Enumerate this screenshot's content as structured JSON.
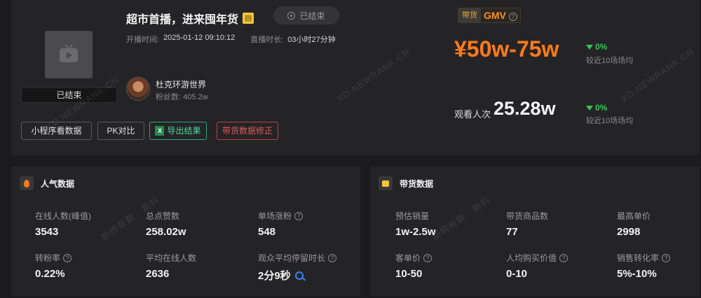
{
  "live": {
    "title": "超市首播，进来囤年货",
    "status": "已结束",
    "cover_status": "已结束",
    "start_label": "开播时间:",
    "start_time": "2025-01-12 09:10:12",
    "duration_label": "直播时长:",
    "duration": "03小时27分钟"
  },
  "anchor": {
    "name": "杜克环游世界",
    "fans_label": "粉丝数:",
    "fans": "405.2w"
  },
  "buttons": {
    "mini_program": "小程序看数据",
    "pk": "PK对比",
    "export": "导出结果",
    "fix": "带货数据修正"
  },
  "gmv": {
    "tag": "带货",
    "label": "GMV",
    "value": "¥50w-75w",
    "trend": "0%",
    "trend_sub": "较近10场场均"
  },
  "viewers": {
    "label": "观看人次",
    "value": "25.28w",
    "trend": "0%",
    "trend_sub": "较近10场场均"
  },
  "popularity": {
    "title": "人气数据",
    "metrics": [
      {
        "label": "在线人数(峰值)",
        "value": "3543"
      },
      {
        "label": "总点赞数",
        "value": "258.02w"
      },
      {
        "label": "单场涨粉",
        "value": "548"
      },
      {
        "label": "转粉率",
        "value": "0.22%"
      },
      {
        "label": "平均在线人数",
        "value": "2636"
      },
      {
        "label": "观众平均停留时长",
        "value": "2分9秒"
      }
    ]
  },
  "sales": {
    "title": "带货数据",
    "metrics": [
      {
        "label": "预估销量",
        "value": "1w-2.5w"
      },
      {
        "label": "带货商品数",
        "value": "77"
      },
      {
        "label": "最高单价",
        "value": "2998"
      },
      {
        "label": "客单价",
        "value": "10-50"
      },
      {
        "label": "人均购买价值",
        "value": "0-10"
      },
      {
        "label": "销售转化率",
        "value": "5%-10%"
      }
    ]
  },
  "watermarks": [
    "XD.NEWRANK.CN",
    "新榜有数 · 新抖"
  ],
  "colors": {
    "accent_orange": "#ff7a1a",
    "trend_green": "#3ac25a",
    "export_green": "#54d6a2",
    "fix_red": "#e35a5a"
  }
}
